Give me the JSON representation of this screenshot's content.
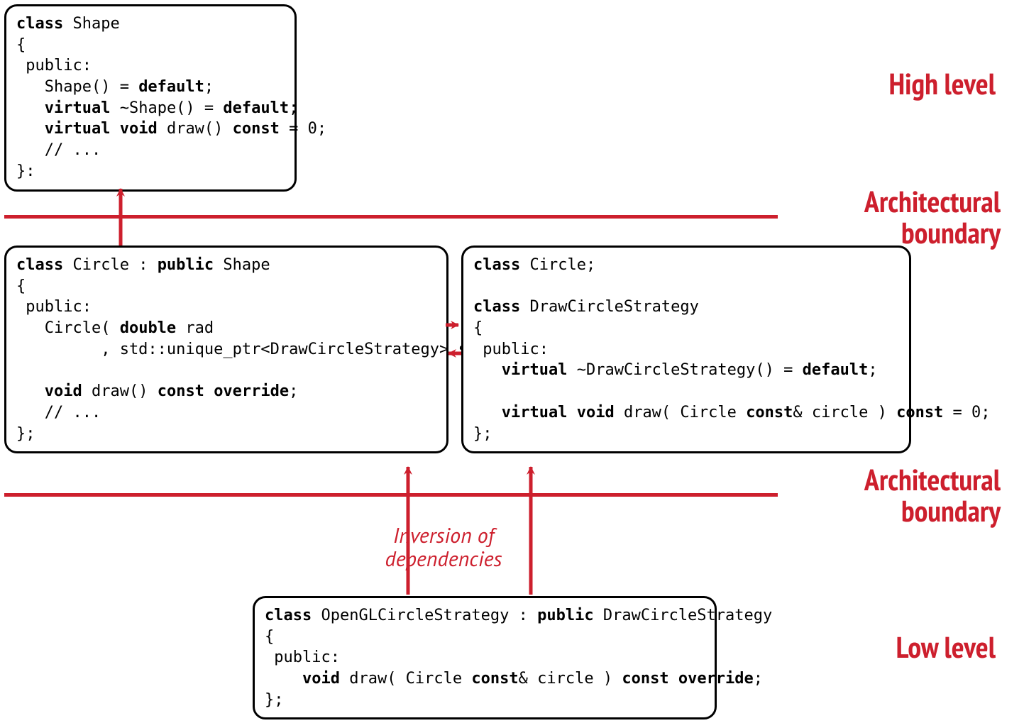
{
  "labels": {
    "highLevel": "High level",
    "lowLevel": "Low level",
    "archBoundary": "Architectural\nboundary",
    "inversion": "Inversion of\ndependencies"
  },
  "boxes": {
    "shape": {
      "lines": [
        [
          {
            "t": "class",
            "b": true
          },
          {
            "t": " Shape"
          }
        ],
        [
          {
            "t": "{"
          }
        ],
        [
          {
            "t": " public:"
          }
        ],
        [
          {
            "t": "   Shape() = "
          },
          {
            "t": "default",
            "b": true
          },
          {
            "t": ";"
          }
        ],
        [
          {
            "t": "   "
          },
          {
            "t": "virtual",
            "b": true
          },
          {
            "t": " ~Shape() = "
          },
          {
            "t": "default",
            "b": true
          },
          {
            "t": ";"
          }
        ],
        [
          {
            "t": "   "
          },
          {
            "t": "virtual",
            "b": true
          },
          {
            "t": " "
          },
          {
            "t": "void",
            "b": true
          },
          {
            "t": " draw() "
          },
          {
            "t": "const",
            "b": true
          },
          {
            "t": " = 0;"
          }
        ],
        [
          {
            "t": "   // ..."
          }
        ],
        [
          {
            "t": "}:"
          }
        ]
      ]
    },
    "circle": {
      "lines": [
        [
          {
            "t": "class",
            "b": true
          },
          {
            "t": " Circle : "
          },
          {
            "t": "public",
            "b": true
          },
          {
            "t": " Shape"
          }
        ],
        [
          {
            "t": "{"
          }
        ],
        [
          {
            "t": " public:"
          }
        ],
        [
          {
            "t": "   Circle( "
          },
          {
            "t": "double",
            "b": true
          },
          {
            "t": " rad"
          }
        ],
        [
          {
            "t": "         , std::unique_ptr<DrawCircleStrategy> strategy );"
          }
        ],
        [
          {
            "t": ""
          }
        ],
        [
          {
            "t": "   "
          },
          {
            "t": "void",
            "b": true
          },
          {
            "t": " draw() "
          },
          {
            "t": "const",
            "b": true
          },
          {
            "t": " "
          },
          {
            "t": "override",
            "b": true
          },
          {
            "t": ";"
          }
        ],
        [
          {
            "t": "   // ..."
          }
        ],
        [
          {
            "t": "};"
          }
        ]
      ]
    },
    "strategy": {
      "lines": [
        [
          {
            "t": "class",
            "b": true
          },
          {
            "t": " Circle;"
          }
        ],
        [
          {
            "t": ""
          }
        ],
        [
          {
            "t": "class",
            "b": true
          },
          {
            "t": " DrawCircleStrategy"
          }
        ],
        [
          {
            "t": "{"
          }
        ],
        [
          {
            "t": " public:"
          }
        ],
        [
          {
            "t": "   "
          },
          {
            "t": "virtual",
            "b": true
          },
          {
            "t": " ~DrawCircleStrategy() = "
          },
          {
            "t": "default",
            "b": true
          },
          {
            "t": ";"
          }
        ],
        [
          {
            "t": ""
          }
        ],
        [
          {
            "t": "   "
          },
          {
            "t": "virtual",
            "b": true
          },
          {
            "t": " "
          },
          {
            "t": "void",
            "b": true
          },
          {
            "t": " draw( Circle "
          },
          {
            "t": "const",
            "b": true
          },
          {
            "t": "& circle ) "
          },
          {
            "t": "const",
            "b": true
          },
          {
            "t": " = 0;"
          }
        ],
        [
          {
            "t": "};"
          }
        ]
      ]
    },
    "opengl": {
      "lines": [
        [
          {
            "t": "class",
            "b": true
          },
          {
            "t": " OpenGLCircleStrategy : "
          },
          {
            "t": "public",
            "b": true
          },
          {
            "t": " DrawCircleStrategy"
          }
        ],
        [
          {
            "t": "{"
          }
        ],
        [
          {
            "t": " public:"
          }
        ],
        [
          {
            "t": "    "
          },
          {
            "t": "void",
            "b": true
          },
          {
            "t": " draw( Circle "
          },
          {
            "t": "const",
            "b": true
          },
          {
            "t": "& circle ) "
          },
          {
            "t": "const",
            "b": true
          },
          {
            "t": " "
          },
          {
            "t": "override",
            "b": true
          },
          {
            "t": ";"
          }
        ],
        [
          {
            "t": "};"
          }
        ]
      ]
    }
  },
  "colors": {
    "accent": "#cd1f2d"
  }
}
